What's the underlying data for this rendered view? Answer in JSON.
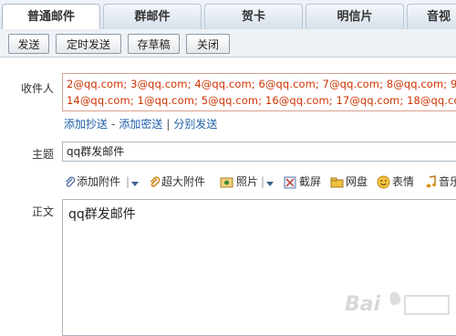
{
  "tabs": [
    "普通邮件",
    "群邮件",
    "贺卡",
    "明信片",
    "音视"
  ],
  "toolbar": {
    "send": "发送",
    "scheduled_send": "定时发送",
    "save_draft": "存草稿",
    "close": "关闭"
  },
  "recipients": {
    "label": "收件人",
    "line1": "2@qq.com; 3@qq.com; 4@qq.com; 6@qq.com; 7@qq.com; 8@qq.com; 9@",
    "line2": "14@qq.com; 1@qq.com; 5@qq.com; 16@qq.com; 17@qq.com; 18@qq.com"
  },
  "recipient_links": {
    "add_cc": "添加抄送",
    "add_bcc": "添加密送",
    "separate_send": "分别发送"
  },
  "subject": {
    "label": "主题",
    "value": "qq群发邮件"
  },
  "attachments": {
    "add_attachment": "添加附件",
    "large_attachment": "超大附件",
    "photo": "照片",
    "screenshot": "截屏",
    "netdisk": "网盘",
    "emoticon": "表情",
    "music": "音乐"
  },
  "body": {
    "label": "正文",
    "value": "qq群发邮件"
  },
  "colors": {
    "recipient_text": "#cc3300",
    "link": "#1f5fa8",
    "recipient_border": "#d9a08e"
  },
  "icons": [
    "paperclip-icon",
    "dropdown-arrow-icon",
    "large-attachment-icon",
    "photo-icon",
    "screenshot-icon",
    "netdisk-icon",
    "emoticon-icon",
    "music-icon"
  ]
}
